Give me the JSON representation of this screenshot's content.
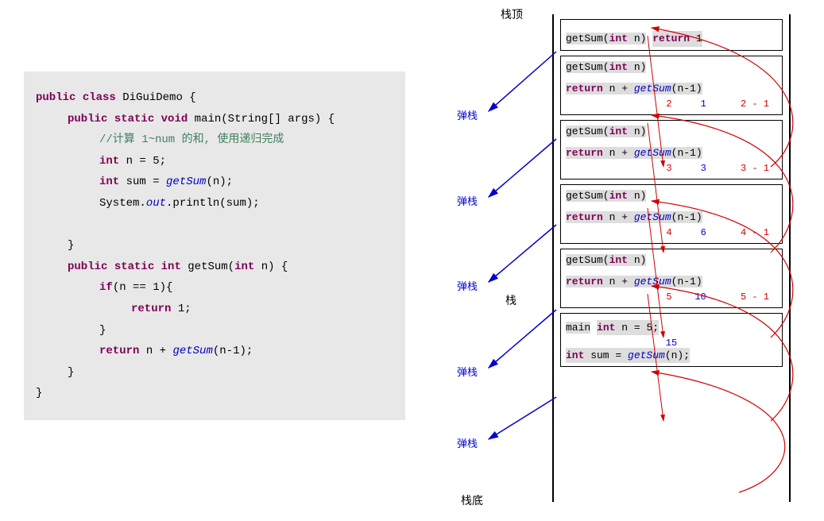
{
  "code": {
    "l1_kw1": "public",
    "l1_kw2": "class",
    "l1_name": " DiGuiDemo {",
    "l2_kw1": "public",
    "l2_kw2": "static",
    "l2_kw3": "void",
    "l2_sig": " main(String[] args) {",
    "l3": "//计算 1~num 的和, 使用递归完成",
    "l4_kw": "int",
    "l4_rest": " n = 5;",
    "l5_kw": "int",
    "l5_rest1": " sum = ",
    "l5_call": "getSum",
    "l5_rest2": "(n);",
    "l6_a": "System.",
    "l6_out": "out",
    "l6_b": ".println(sum);",
    "l7": "}",
    "l8_kw1": "public",
    "l8_kw2": "static",
    "l8_kw3": "int",
    "l8_sig1": " getSum(",
    "l8_kw4": "int",
    "l8_sig2": " n) {",
    "l9_kw": "if",
    "l9_rest": "(n == 1){",
    "l10_kw": "return",
    "l10_rest": " 1;",
    "l11": "}",
    "l12_kw": "return",
    "l12_rest1": " n + ",
    "l12_call": "getSum",
    "l12_rest2": "(n-1);",
    "l13": "}",
    "l14": "}"
  },
  "labels": {
    "stack_top": "栈顶",
    "stack_mid": "栈",
    "stack_bot": "栈底",
    "pop": "弹栈"
  },
  "frames": [
    {
      "sig_pre": "getSum(",
      "sig_kw": "int",
      "sig_post": " n)",
      "ret_kw": "return",
      "ret_rest": " 1",
      "vals_a": "",
      "vals_b": "",
      "vals_c": ""
    },
    {
      "sig_pre": "getSum(",
      "sig_kw": "int",
      "sig_post": " n)",
      "ret_kw": "return",
      "ret_rest1": " n + ",
      "ret_call": "getSum",
      "ret_rest2": "(n-1)",
      "vals_a": "2",
      "vals_b": "1",
      "vals_c": "2 - 1"
    },
    {
      "sig_pre": "getSum(",
      "sig_kw": "int",
      "sig_post": " n)",
      "ret_kw": "return",
      "ret_rest1": " n + ",
      "ret_call": "getSum",
      "ret_rest2": "(n-1)",
      "vals_a": "3",
      "vals_b": "3",
      "vals_c": "3 - 1"
    },
    {
      "sig_pre": "getSum(",
      "sig_kw": "int",
      "sig_post": " n)",
      "ret_kw": "return",
      "ret_rest1": " n + ",
      "ret_call": "getSum",
      "ret_rest2": "(n-1)",
      "vals_a": "4",
      "vals_b": "6",
      "vals_c": "4 - 1"
    },
    {
      "sig_pre": "getSum(",
      "sig_kw": "int",
      "sig_post": " n)",
      "ret_kw": "return",
      "ret_rest1": " n + ",
      "ret_call": "getSum",
      "ret_rest2": "(n-1)",
      "vals_a": "5",
      "vals_b": "10",
      "vals_c": "5 - 1"
    }
  ],
  "main_frame": {
    "sig": "main",
    "l1_kw": "int",
    "l1_rest": " n = 5;",
    "result": "15",
    "l2_kw": "int",
    "l2_rest1": " sum = ",
    "l2_call": "getSum",
    "l2_rest2": "(n);"
  }
}
